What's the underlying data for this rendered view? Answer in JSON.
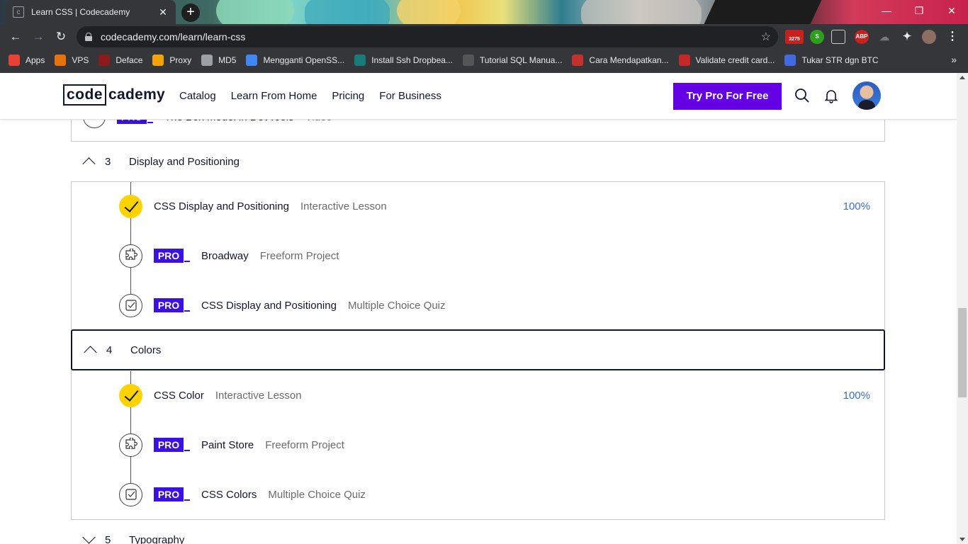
{
  "browser": {
    "tab_title": "Learn CSS | Codecademy",
    "url": "codecademy.com/learn/learn-css",
    "new_tab": "+",
    "gmail_badge": "3275",
    "bookmarks": [
      {
        "label": "Apps",
        "color": "#e94235",
        "icon": "apps-grid-icon"
      },
      {
        "label": "VPS",
        "color": "#e8710a",
        "icon": "1"
      },
      {
        "label": "Deface",
        "color": "#8b1a1a",
        "icon": "deface-icon"
      },
      {
        "label": "Proxy",
        "color": "#f4a300",
        "icon": "G"
      },
      {
        "label": "MD5",
        "color": "#9aa0a6",
        "icon": "doc-icon"
      },
      {
        "label": "Mengganti OpenSS...",
        "color": "#4285f4",
        "icon": "e"
      },
      {
        "label": "Install Ssh Dropbea...",
        "color": "#1a7b7b",
        "icon": "Sg"
      },
      {
        "label": "Tutorial SQL Manua...",
        "color": "#555555",
        "icon": "YE"
      },
      {
        "label": "Cara Mendapatkan...",
        "color": "#c4302b",
        "icon": "P"
      },
      {
        "label": "Validate credit card...",
        "color": "#c62828",
        "icon": "shield"
      },
      {
        "label": "Tukar STR dgn BTC",
        "color": "#4169e1",
        "icon": "DX"
      }
    ]
  },
  "header": {
    "logo_box": "code",
    "logo_rest": "cademy",
    "nav": [
      "Catalog",
      "Learn From Home",
      "Pricing",
      "For Business"
    ],
    "cta": "Try Pro For Free"
  },
  "outline": {
    "partial_item": {
      "title": "The Box Model in DevTools",
      "type": "Video"
    },
    "chapters": [
      {
        "number": "3",
        "name": "Display and Positioning",
        "expanded": true,
        "items": [
          {
            "title": "CSS Display and Positioning",
            "type": "Interactive Lesson",
            "status": "complete",
            "progress": "100%",
            "pro": false
          },
          {
            "title": "Broadway",
            "type": "Freeform Project",
            "status": "locked",
            "icon": "puzzle-icon",
            "pro": true
          },
          {
            "title": "CSS Display and Positioning",
            "type": "Multiple Choice Quiz",
            "status": "locked",
            "icon": "quiz-icon",
            "pro": true
          }
        ]
      },
      {
        "number": "4",
        "name": "Colors",
        "expanded": true,
        "items": [
          {
            "title": "CSS Color",
            "type": "Interactive Lesson",
            "status": "complete",
            "progress": "100%",
            "pro": false
          },
          {
            "title": "Paint Store",
            "type": "Freeform Project",
            "status": "locked",
            "icon": "puzzle-icon",
            "pro": true
          },
          {
            "title": "CSS Colors",
            "type": "Multiple Choice Quiz",
            "status": "locked",
            "icon": "quiz-icon",
            "pro": true
          }
        ]
      },
      {
        "number": "5",
        "name": "Typography",
        "expanded": false
      }
    ],
    "pro_label": "PRO"
  },
  "colors": {
    "brand_purple": "#6400e4",
    "pro_tag": "#3a10e5",
    "complete_yellow": "#ffd300",
    "progress_blue": "#3a6ec9",
    "text_navy": "#10162f"
  }
}
